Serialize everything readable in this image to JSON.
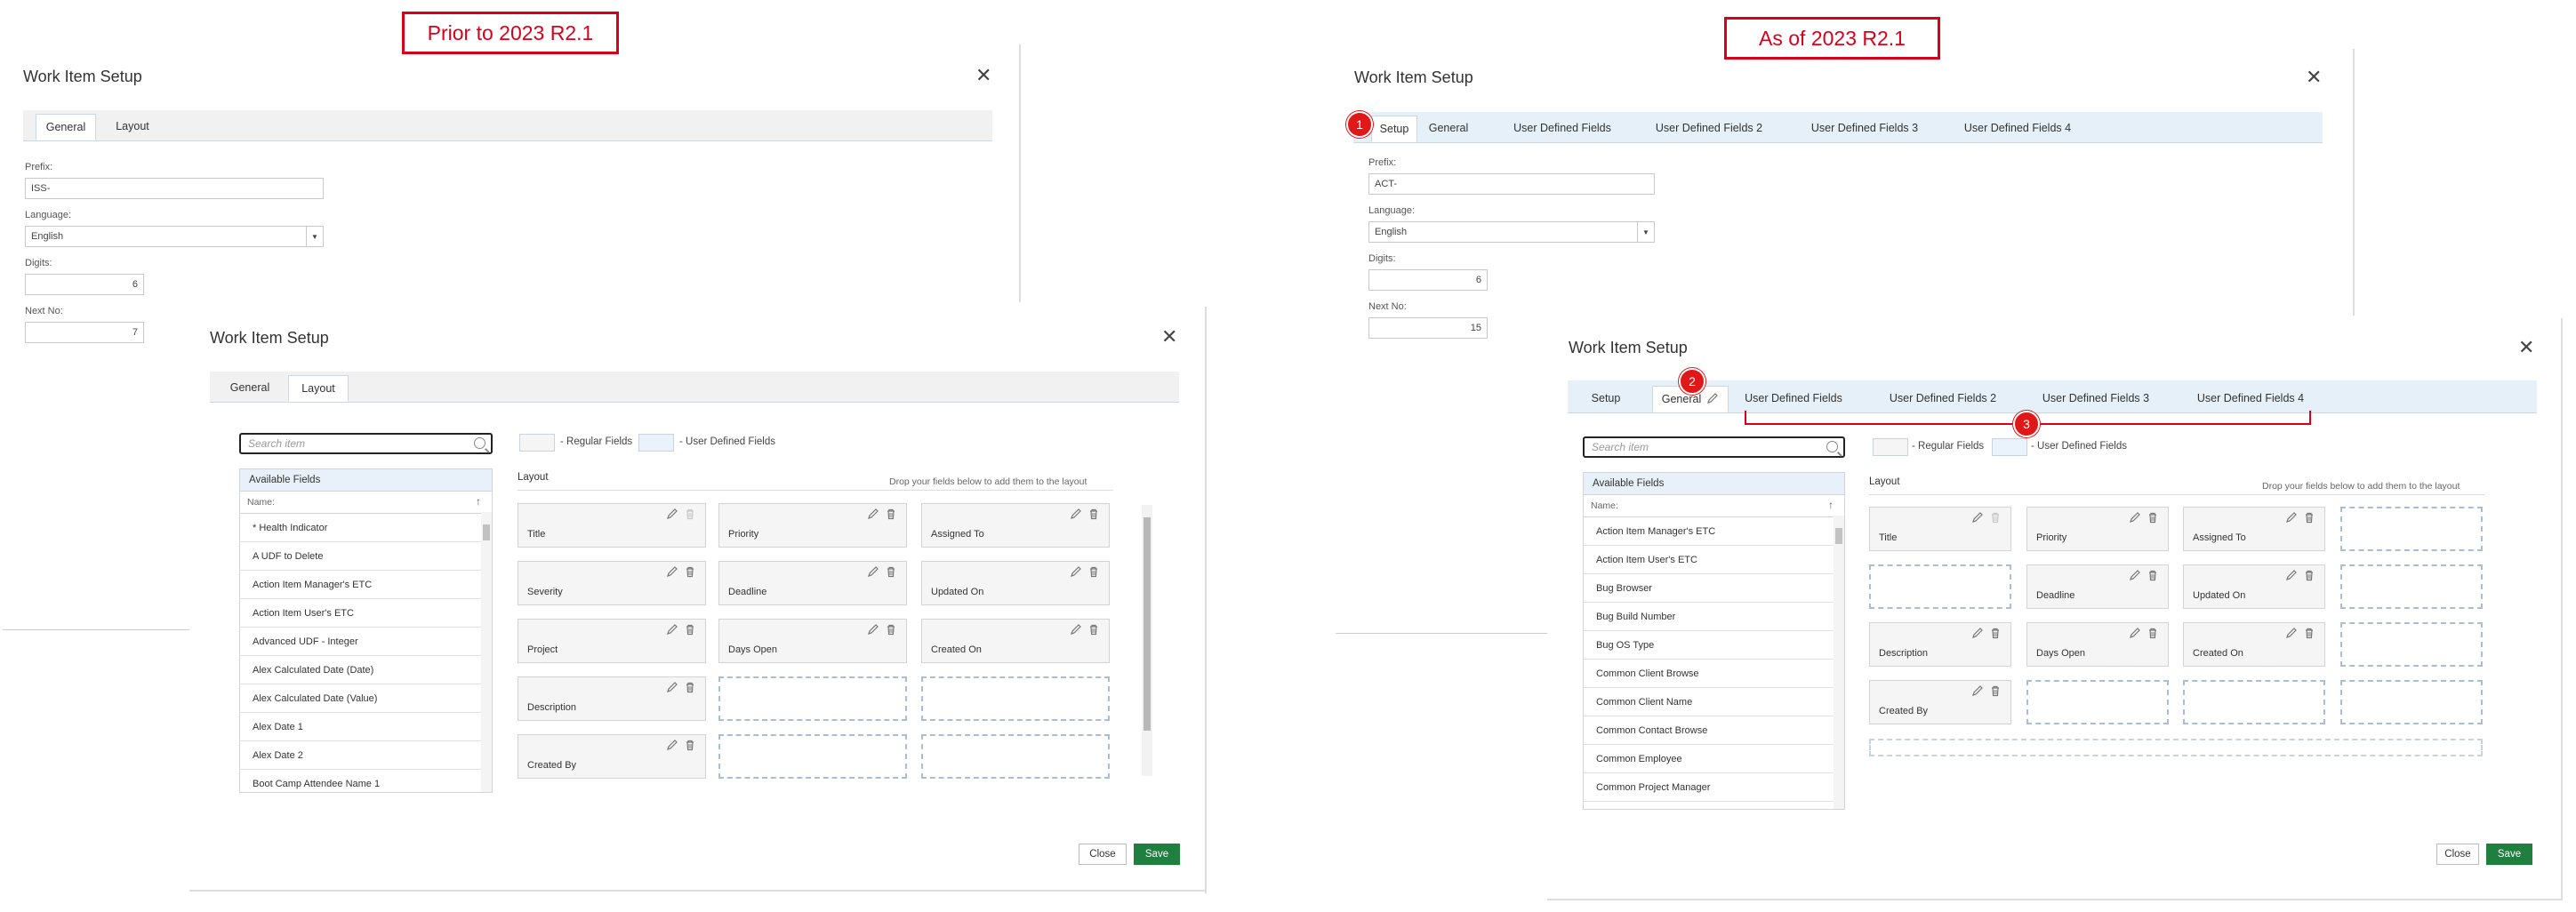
{
  "callouts": {
    "left": "Prior to 2023 R2.1",
    "right": "As of 2023 R2.1"
  },
  "old_general": {
    "title": "Work Item Setup",
    "tabs": [
      "General",
      "Layout"
    ],
    "prefix_label": "Prefix:",
    "prefix_value": "ISS-",
    "language_label": "Language:",
    "language_value": "English",
    "digits_label": "Digits:",
    "digits_value": "6",
    "next_label": "Next No:",
    "next_value": "7"
  },
  "old_layout": {
    "title": "Work Item Setup",
    "tabs": [
      "General",
      "Layout"
    ],
    "search_placeholder": "Search item",
    "available_header": "Available Fields",
    "name_col": "Name:",
    "fields": [
      "* Health Indicator",
      "A UDF to Delete",
      "Action Item Manager's ETC",
      "Action Item User's ETC",
      "Advanced UDF - Integer",
      "Alex Calculated Date (Date)",
      "Alex Calculated Date (Value)",
      "Alex Date 1",
      "Alex Date 2",
      "Boot Camp Attendee Name 1"
    ],
    "legend_regular": "- Regular Fields",
    "legend_udf": "- User Defined Fields",
    "layout_label": "Layout",
    "drop_hint": "Drop your fields below to add them to the layout",
    "cards": [
      "Title",
      "Priority",
      "Assigned To",
      "Severity",
      "Deadline",
      "Updated On",
      "Project",
      "Days Open",
      "Created On",
      "Description",
      "Created By"
    ],
    "close_label": "Close",
    "save_label": "Save"
  },
  "new_general": {
    "title": "Work Item Setup",
    "tabs": [
      "Setup",
      "General",
      "User Defined Fields",
      "User Defined Fields 2",
      "User Defined Fields 3",
      "User Defined Fields 4"
    ],
    "prefix_label": "Prefix:",
    "prefix_value": "ACT-",
    "language_label": "Language:",
    "language_value": "English",
    "digits_label": "Digits:",
    "digits_value": "6",
    "next_label": "Next No:",
    "next_value": "15",
    "badge": "1"
  },
  "new_layout": {
    "title": "Work Item Setup",
    "tabs": [
      "Setup",
      "General",
      "User Defined Fields",
      "User Defined Fields 2",
      "User Defined Fields 3",
      "User Defined Fields 4"
    ],
    "search_placeholder": "Search item",
    "available_header": "Available Fields",
    "name_col": "Name:",
    "fields": [
      "Action Item Manager's ETC",
      "Action Item User's ETC",
      "Bug Browser",
      "Bug Build Number",
      "Bug OS Type",
      "Common Client Browse",
      "Common Client Name",
      "Common Contact Browse",
      "Common Employee",
      "Common Project Manager"
    ],
    "legend_regular": "- Regular Fields",
    "legend_udf": "- User Defined Fields",
    "layout_label": "Layout",
    "drop_hint": "Drop your fields below to add them to the layout",
    "cards": [
      "Title",
      "Priority",
      "Assigned To",
      "Deadline",
      "Updated On",
      "Description",
      "Days Open",
      "Created On",
      "Created By"
    ],
    "close_label": "Close",
    "save_label": "Save",
    "badge2": "2",
    "badge3": "3"
  },
  "colors": {
    "callout_red": "#d9001b",
    "badge_red": "#e01818",
    "save_green": "#1f7f3f",
    "tab_bar_old": "#f1f1f1",
    "tab_bar_new": "#e6f0f8",
    "list_header": "#e8f1fa"
  },
  "icons": [
    "pencil-icon",
    "trash-icon",
    "search-icon",
    "close-icon",
    "chevron-down-icon",
    "sort-icon"
  ]
}
